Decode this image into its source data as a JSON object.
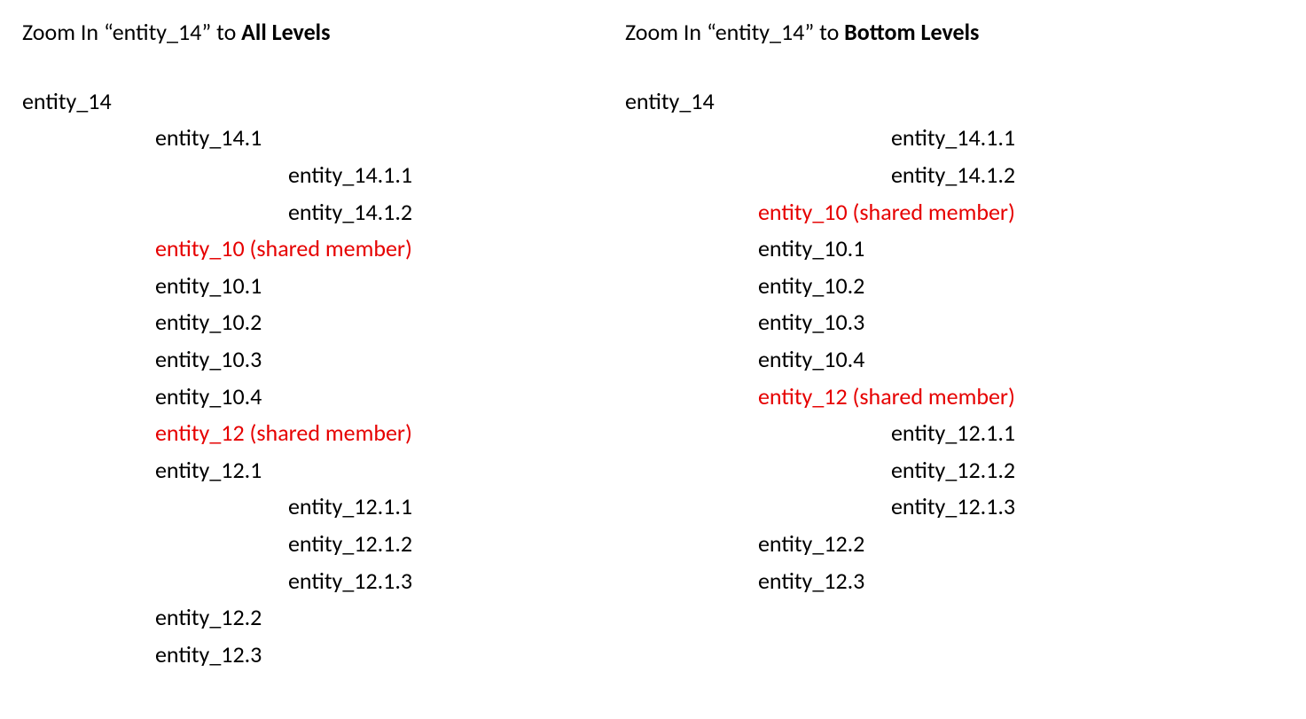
{
  "left": {
    "heading_prefix": "Zoom In “entity_14” to ",
    "heading_bold": "All Levels",
    "items": [
      {
        "label": "entity_14",
        "indent": 0,
        "shared": false
      },
      {
        "label": "entity_14.1",
        "indent": 1,
        "shared": false
      },
      {
        "label": "entity_14.1.1",
        "indent": 2,
        "shared": false
      },
      {
        "label": "entity_14.1.2",
        "indent": 2,
        "shared": false
      },
      {
        "label": "entity_10 (shared member)",
        "indent": 1,
        "shared": true
      },
      {
        "label": "entity_10.1",
        "indent": 1,
        "shared": false
      },
      {
        "label": "entity_10.2",
        "indent": 1,
        "shared": false
      },
      {
        "label": "entity_10.3",
        "indent": 1,
        "shared": false
      },
      {
        "label": "entity_10.4",
        "indent": 1,
        "shared": false
      },
      {
        "label": "entity_12 (shared member)",
        "indent": 1,
        "shared": true
      },
      {
        "label": "entity_12.1",
        "indent": 1,
        "shared": false
      },
      {
        "label": "entity_12.1.1",
        "indent": 2,
        "shared": false
      },
      {
        "label": "entity_12.1.2",
        "indent": 2,
        "shared": false
      },
      {
        "label": "entity_12.1.3",
        "indent": 2,
        "shared": false
      },
      {
        "label": "entity_12.2",
        "indent": 1,
        "shared": false
      },
      {
        "label": "entity_12.3",
        "indent": 1,
        "shared": false
      }
    ]
  },
  "right": {
    "heading_prefix": "Zoom In “entity_14” to ",
    "heading_bold": "Bottom Levels",
    "items": [
      {
        "label": "entity_14",
        "indent": 0,
        "shared": false
      },
      {
        "label": "entity_14.1.1",
        "indent": 2,
        "shared": false
      },
      {
        "label": "entity_14.1.2",
        "indent": 2,
        "shared": false
      },
      {
        "label": "entity_10 (shared member)",
        "indent": 1,
        "shared": true
      },
      {
        "label": "entity_10.1",
        "indent": 1,
        "shared": false
      },
      {
        "label": "entity_10.2",
        "indent": 1,
        "shared": false
      },
      {
        "label": "entity_10.3",
        "indent": 1,
        "shared": false
      },
      {
        "label": "entity_10.4",
        "indent": 1,
        "shared": false
      },
      {
        "label": "entity_12 (shared member)",
        "indent": 1,
        "shared": true
      },
      {
        "label": "entity_12.1.1",
        "indent": 2,
        "shared": false
      },
      {
        "label": "entity_12.1.2",
        "indent": 2,
        "shared": false
      },
      {
        "label": "entity_12.1.3",
        "indent": 2,
        "shared": false
      },
      {
        "label": "entity_12.2",
        "indent": 1,
        "shared": false
      },
      {
        "label": "entity_12.3",
        "indent": 1,
        "shared": false
      }
    ]
  }
}
